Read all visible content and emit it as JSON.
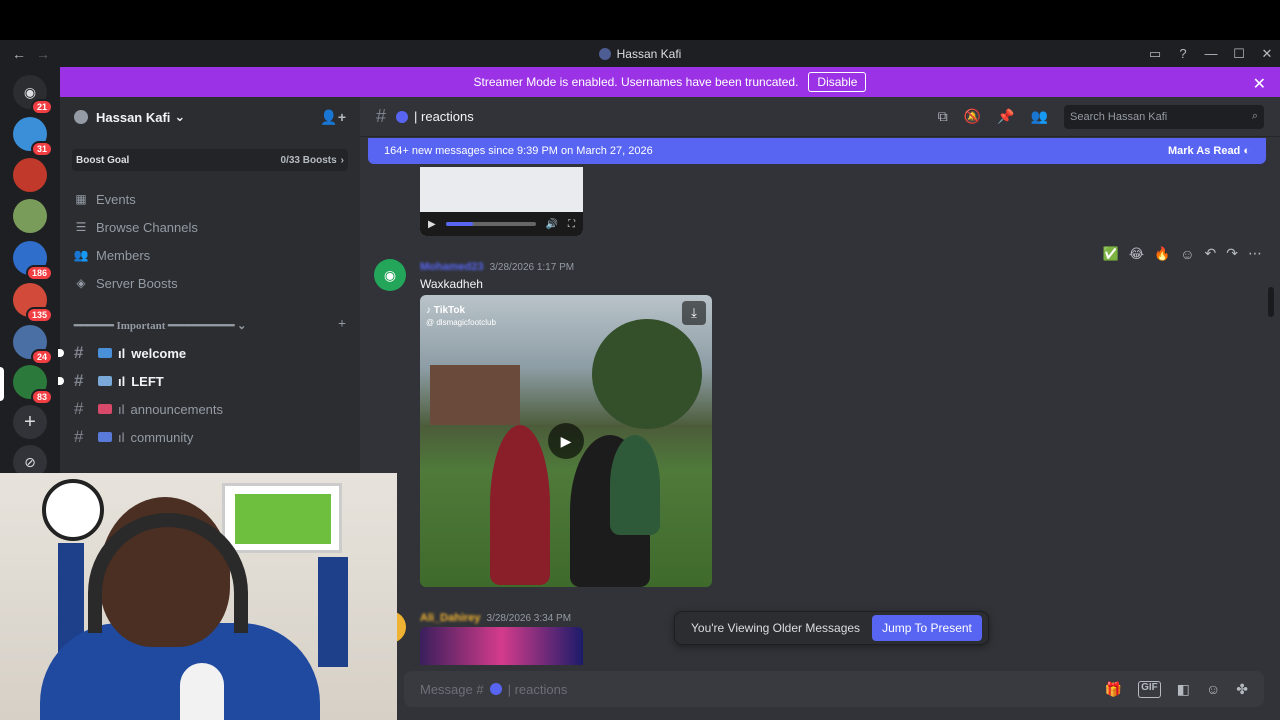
{
  "window": {
    "title": "Hassan Kafi",
    "back": "←",
    "forward": "→",
    "controls": [
      "▭",
      "?",
      "—",
      "☐",
      "✕"
    ]
  },
  "servers": [
    {
      "badge": "21",
      "color": "#5865f2"
    },
    {
      "badge": "31",
      "color": "#3b8ed8"
    },
    {
      "badge": "",
      "color": "#c0392b"
    },
    {
      "badge": "",
      "color": "#7a9c5a"
    },
    {
      "badge": "186",
      "color": "#2f6ecb"
    },
    {
      "badge": "135",
      "color": "#d14a3a"
    },
    {
      "badge": "24",
      "color": "#4a6fa5"
    },
    {
      "badge": "83",
      "color": "#2b7a3b"
    }
  ],
  "server_actions": {
    "add": "+",
    "explore": "⊘"
  },
  "banner": {
    "text": "Streamer Mode is enabled. Usernames have been truncated.",
    "button": "Disable",
    "close": "✕"
  },
  "guild": {
    "name": "Hassan Kafi",
    "chevron": "⌄",
    "boost_label": "Boost Goal",
    "boost_count": "0/33 Boosts",
    "menu": [
      {
        "icon": "calendar-icon",
        "glyph": "▦",
        "label": "Events"
      },
      {
        "icon": "browse-icon",
        "glyph": "☰",
        "label": "Browse Channels"
      },
      {
        "icon": "members-icon",
        "glyph": "👥",
        "label": "Members"
      },
      {
        "icon": "boost-icon",
        "glyph": "◈",
        "label": "Server Boosts"
      }
    ],
    "category": "━━━━━━ Important ━━━━━━━━━━ ⌄",
    "category_add": "+",
    "channels": [
      {
        "label": "welcome",
        "prefix": "ıl",
        "unread": true,
        "emoji_color": "#4a90d9"
      },
      {
        "label": "LEFT",
        "prefix": "ıl",
        "unread": true,
        "emoji_color": "#7aa9d9"
      },
      {
        "label": "announcements",
        "prefix": "ıl",
        "unread": false,
        "emoji_color": "#d94a6a"
      },
      {
        "label": "community",
        "prefix": "ıl",
        "unread": false,
        "emoji_color": "#5a7ad9"
      }
    ]
  },
  "channel": {
    "name": "| reactions",
    "search_placeholder": "Search Hassan Kafi",
    "new_messages": "164+ new messages since 9:39 PM on March 27, 2026",
    "mark_as_read": "Mark As Read"
  },
  "messages": [
    {
      "username": "Mohamed23",
      "timestamp": "3/28/2026 1:17 PM",
      "text": "Waxkadheh",
      "tiktok_handle": "@ dlsmagicfootclub",
      "tiktok_brand": "TikTok"
    },
    {
      "username": "Ali_Dahirey",
      "timestamp": "3/28/2026 3:34 PM"
    }
  ],
  "reactions_bar": [
    "✅",
    "😂",
    "🔥"
  ],
  "older_bar": {
    "text": "You're Viewing Older Messages",
    "button": "Jump To Present"
  },
  "composer": {
    "placeholder_prefix": "Message #",
    "placeholder_channel": "| reactions"
  }
}
